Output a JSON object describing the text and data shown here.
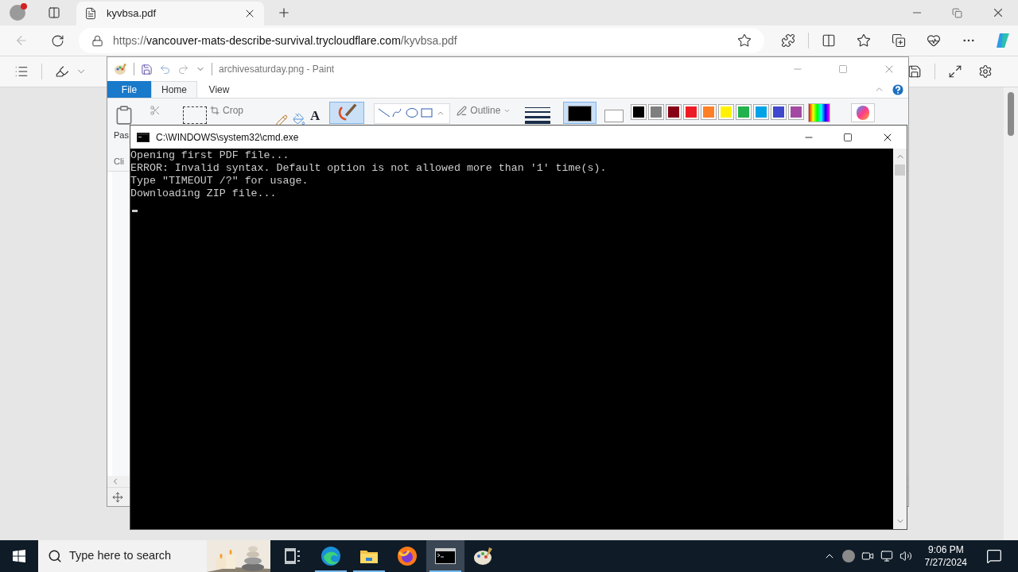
{
  "browser": {
    "tab": {
      "title": "kyvbsa.pdf"
    },
    "url": {
      "scheme": "https://",
      "host": "vancouver-mats-describe-survival.trycloudflare.com",
      "path": "/kyvbsa.pdf"
    }
  },
  "paint": {
    "title": "archivesaturday.png - Paint",
    "tabs": [
      {
        "label": "File",
        "kind": "file",
        "selected": false
      },
      {
        "label": "Home",
        "kind": "tab",
        "selected": true
      },
      {
        "label": "View",
        "kind": "tab",
        "selected": false
      }
    ],
    "paste_label": "Pas",
    "text_tool": "A",
    "clipboard_label": "Cli",
    "crop_label": "Crop",
    "outline_label": "Outline",
    "palette": [
      {
        "color": "#000000"
      },
      {
        "color": "#7f7f7f"
      },
      {
        "color": "#880015"
      },
      {
        "color": "#ed1c24"
      },
      {
        "color": "#ff7f27"
      },
      {
        "color": "#fff200"
      },
      {
        "color": "#22b14c"
      },
      {
        "color": "#00a2e8"
      },
      {
        "color": "#3f48cc"
      },
      {
        "color": "#a349a4"
      }
    ],
    "color1": {
      "color": "#000000",
      "selected": true
    },
    "color2": {
      "color": "#ffffff",
      "selected": false
    }
  },
  "cmd": {
    "title": "C:\\WINDOWS\\system32\\cmd.exe",
    "lines": [
      "Opening first PDF file...",
      "ERROR: Invalid syntax. Default option is not allowed more than '1' time(s).",
      "Type \"TIMEOUT /?\" for usage.",
      "Downloading ZIP file..."
    ]
  },
  "taskbar": {
    "search": {
      "placeholder": "Type here to search"
    },
    "apps": [
      {
        "kind": "taskview",
        "running": false,
        "selected": false
      },
      {
        "kind": "edge",
        "running": true,
        "selected": false
      },
      {
        "kind": "explorer",
        "running": true,
        "selected": false
      },
      {
        "kind": "firefox",
        "running": false,
        "selected": false
      },
      {
        "kind": "cmd",
        "running": true,
        "selected": true
      },
      {
        "kind": "paint",
        "running": false,
        "selected": false
      }
    ],
    "time": "9:06 PM",
    "date": "7/27/2024"
  }
}
